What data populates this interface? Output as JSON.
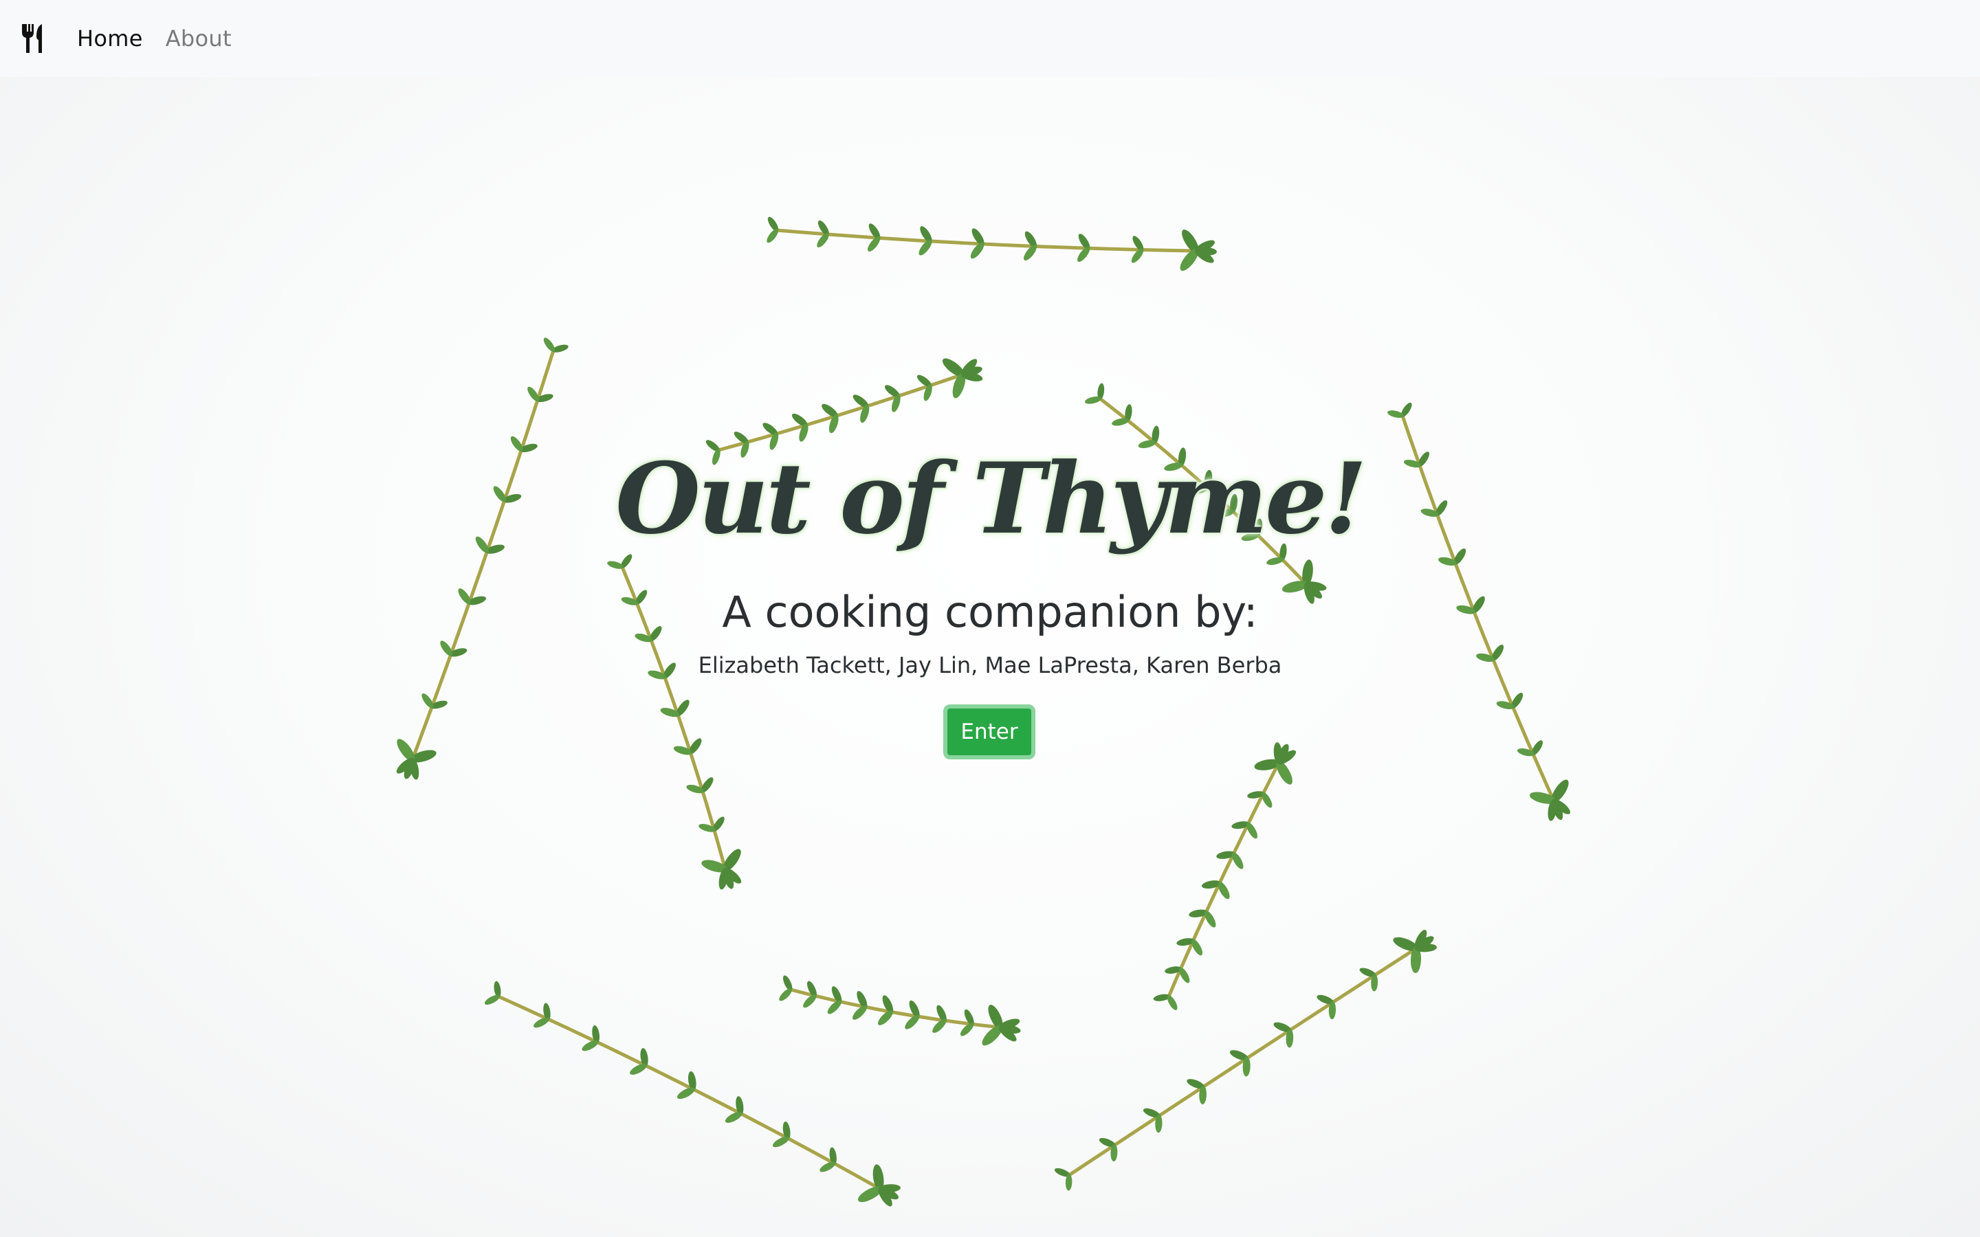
{
  "navbar": {
    "brand_icon": "fork-knife-icon",
    "links": [
      {
        "label": "Home",
        "active": true
      },
      {
        "label": "About",
        "active": false
      }
    ]
  },
  "hero": {
    "title": "Out of Thyme!",
    "subtitle": "A cooking companion by:",
    "authors": "Elizabeth Tackett, Jay Lin, Mae LaPresta, Karen Berba",
    "enter_label": "Enter"
  },
  "colors": {
    "button_bg": "#28a745",
    "button_focus_ring": "#89d49c",
    "title_color": "#2f3b39",
    "navbar_bg": "#f8f9fa",
    "sprig_leaf": "#4f8a3a",
    "sprig_stem": "#a8a44a"
  }
}
